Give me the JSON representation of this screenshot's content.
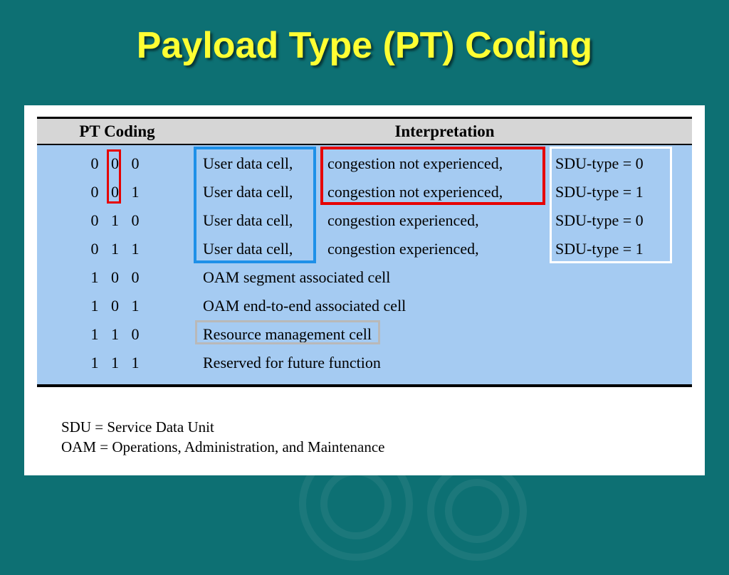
{
  "title": "Payload Type  (PT) Coding",
  "headers": {
    "pt": "PT Coding",
    "interp": "Interpretation"
  },
  "rows": [
    {
      "code": "0 0 0",
      "a": "User data cell,",
      "b": "congestion not experienced,",
      "c": "SDU-type = 0"
    },
    {
      "code": "0 0 1",
      "a": "User data cell,",
      "b": "congestion not experienced,",
      "c": "SDU-type = 1"
    },
    {
      "code": "0 1 0",
      "a": "User data cell,",
      "b": "congestion experienced,",
      "c": "SDU-type = 0"
    },
    {
      "code": "0 1 1",
      "a": "User data cell,",
      "b": "congestion experienced,",
      "c": "SDU-type = 1"
    },
    {
      "code": "1 0 0",
      "span": "OAM segment associated cell"
    },
    {
      "code": "1 0 1",
      "span": "OAM end-to-end associated cell"
    },
    {
      "code": "1 1 0",
      "span": "Resource management cell"
    },
    {
      "code": "1 1 1",
      "span": "Reserved for future function"
    }
  ],
  "legend": {
    "sdu": "SDU  =  Service Data Unit",
    "oam": "OAM  =  Operations, Administration, and Maintenance"
  }
}
